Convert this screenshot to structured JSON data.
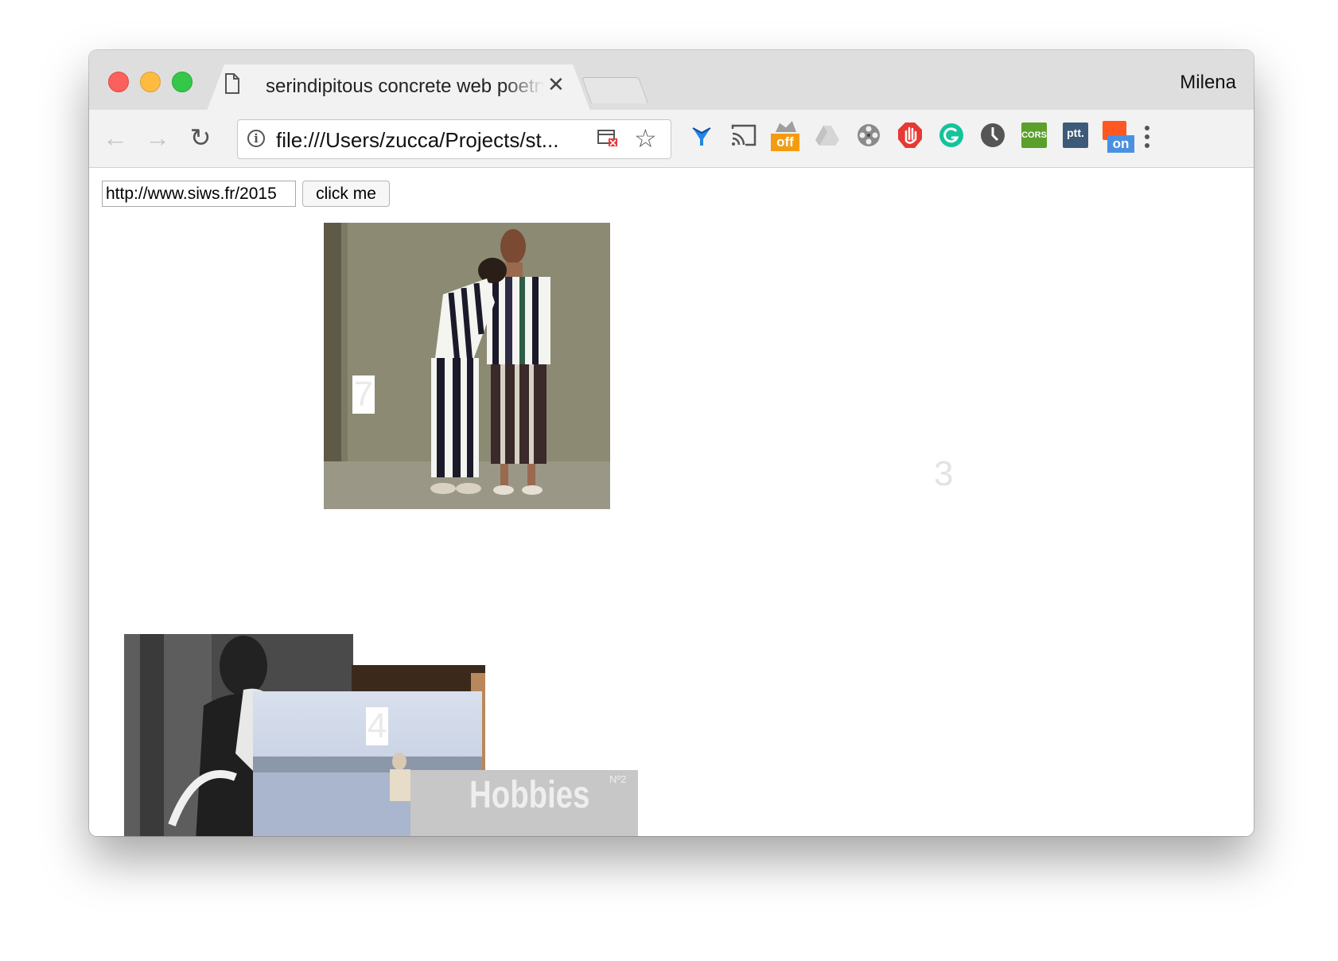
{
  "window": {
    "tab_title": "serindipitous concrete web poetry",
    "profile_name": "Milena"
  },
  "toolbar": {
    "url": "file:///Users/zucca/Projects/st...",
    "extensions": [
      "vpn-icon",
      "cast-icon",
      "off-toggle-icon",
      "drive-icon",
      "film-reel-icon",
      "adblock-icon",
      "grammarly-icon",
      "clock-icon",
      "cors-icon",
      "ptt-icon",
      "on-toggle-icon"
    ],
    "ext_labels": {
      "off": "off",
      "cors": "CORS",
      "ptt": "ptt.",
      "on": "on"
    }
  },
  "page": {
    "url_input_value": "http://www.siws.fr/2015",
    "button_label": "click me",
    "number_3": "3",
    "number_7": "7",
    "number_4": "4",
    "hobbies_text": "Hobbies",
    "hobbies_sup": "Nº2"
  },
  "colors": {
    "titlebar": "#dedede",
    "toolbar": "#f2f2f2",
    "traffic_red": "#fc605c",
    "traffic_yellow": "#fdbc40",
    "traffic_green": "#34c749"
  }
}
